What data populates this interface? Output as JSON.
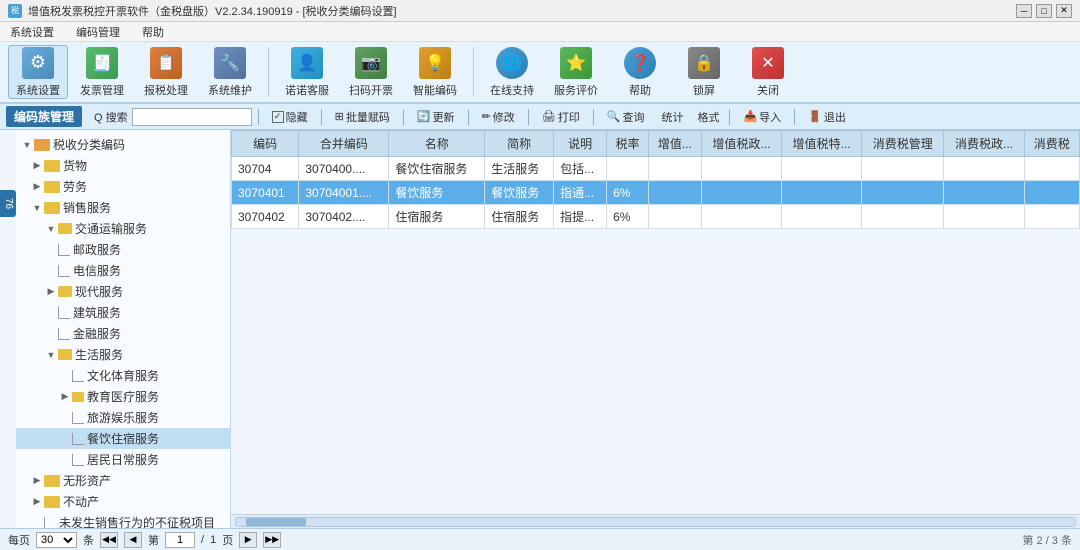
{
  "titleBar": {
    "title": "增值税发票税控开票软件（金税盘版）V2.2.34.190919 - [税收分类编码设置]",
    "controls": [
      "─",
      "□",
      "✕"
    ]
  },
  "menuBar": {
    "items": [
      "系统设置",
      "编码管理",
      "帮助"
    ]
  },
  "toolbar": {
    "buttons": [
      {
        "id": "sys-settings",
        "label": "系统设置",
        "icon": "⚙"
      },
      {
        "id": "invoice-mgmt",
        "label": "发票管理",
        "icon": "🧾"
      },
      {
        "id": "tax-process",
        "label": "报税处理",
        "icon": "📋"
      },
      {
        "id": "sys-maintain",
        "label": "系统维护",
        "icon": "🔧"
      },
      {
        "id": "nuonuo",
        "label": "诺诺客服",
        "icon": "👤"
      },
      {
        "id": "scan-invoice",
        "label": "扫码开票",
        "icon": "📷"
      },
      {
        "id": "smart-code",
        "label": "智能编码",
        "icon": "💡"
      },
      {
        "id": "online-support",
        "label": "在线支持",
        "icon": "🌐"
      },
      {
        "id": "evaluate",
        "label": "服务评价",
        "icon": "⭐"
      },
      {
        "id": "help",
        "label": "帮助",
        "icon": "❓"
      },
      {
        "id": "lock-screen",
        "label": "锁屏",
        "icon": "🔒"
      },
      {
        "id": "close",
        "label": "关闭",
        "icon": "✕"
      }
    ]
  },
  "actionBar": {
    "sectionTitle": "编码族管理",
    "searchLabel": "Q 搜索",
    "searchPlaceholder": "",
    "buttons": [
      {
        "id": "hide",
        "label": "隐藏",
        "hasCheckbox": true
      },
      {
        "id": "batch-assign",
        "label": "批量赋码"
      },
      {
        "id": "update",
        "label": "更新"
      },
      {
        "id": "modify",
        "label": "修改"
      },
      {
        "id": "print",
        "label": "打印"
      },
      {
        "id": "query",
        "label": "查询"
      },
      {
        "id": "stats",
        "label": "统计"
      },
      {
        "id": "grid",
        "label": "格式"
      },
      {
        "id": "import",
        "label": "导入"
      },
      {
        "id": "exit",
        "label": "退出"
      }
    ]
  },
  "sidebar": {
    "title": "税收分类编码",
    "tree": [
      {
        "id": "root",
        "label": "税收分类编码",
        "level": 0,
        "expanded": true,
        "type": "root"
      },
      {
        "id": "goods",
        "label": "货物",
        "level": 1,
        "expanded": false,
        "type": "folder"
      },
      {
        "id": "labor",
        "label": "劳务",
        "level": 1,
        "expanded": false,
        "type": "folder"
      },
      {
        "id": "sales-service",
        "label": "销售服务",
        "level": 1,
        "expanded": true,
        "type": "folder"
      },
      {
        "id": "transport",
        "label": "交通运输服务",
        "level": 2,
        "expanded": false,
        "type": "folder"
      },
      {
        "id": "postal",
        "label": "邮政服务",
        "level": 2,
        "expanded": false,
        "type": "leaf"
      },
      {
        "id": "telecom",
        "label": "电信服务",
        "level": 2,
        "expanded": false,
        "type": "leaf"
      },
      {
        "id": "modern",
        "label": "现代服务",
        "level": 2,
        "expanded": false,
        "type": "folder"
      },
      {
        "id": "construction",
        "label": "建筑服务",
        "level": 2,
        "expanded": false,
        "type": "leaf"
      },
      {
        "id": "finance",
        "label": "金融服务",
        "level": 2,
        "expanded": false,
        "type": "leaf"
      },
      {
        "id": "life",
        "label": "生活服务",
        "level": 2,
        "expanded": true,
        "type": "folder"
      },
      {
        "id": "culture-sport",
        "label": "文化体育服务",
        "level": 3,
        "expanded": false,
        "type": "leaf"
      },
      {
        "id": "edu-medical",
        "label": "教育医疗服务",
        "level": 3,
        "expanded": false,
        "type": "folder"
      },
      {
        "id": "travel-entertainment",
        "label": "旅游娱乐服务",
        "level": 3,
        "expanded": false,
        "type": "leaf"
      },
      {
        "id": "catering-hotel",
        "label": "餐饮住宿服务",
        "level": 3,
        "expanded": false,
        "type": "leaf",
        "selected": true
      },
      {
        "id": "daily-life",
        "label": "居民日常服务",
        "level": 3,
        "expanded": false,
        "type": "leaf"
      },
      {
        "id": "intangible",
        "label": "无形资产",
        "level": 1,
        "expanded": false,
        "type": "folder"
      },
      {
        "id": "realestate",
        "label": "不动产",
        "level": 1,
        "expanded": false,
        "type": "folder"
      },
      {
        "id": "non-sales",
        "label": "未发生销售行为的不征税项目",
        "level": 1,
        "expanded": false,
        "type": "leaf"
      }
    ]
  },
  "table": {
    "columns": [
      "编码",
      "合并编码",
      "名称",
      "简称",
      "说明",
      "税率",
      "增值...",
      "增值税政...",
      "增值税特...",
      "消费税管理",
      "消费税政...",
      "消费税"
    ],
    "rows": [
      {
        "id": "30704",
        "code": "30704",
        "mergeCode": "3070400....",
        "name": "餐饮住宿服务",
        "shortName": "生活服务",
        "note": "包括...",
        "taxRate": "",
        "col7": "",
        "col8": "",
        "col9": "",
        "col10": "",
        "col11": "",
        "col12": "",
        "selected": false
      },
      {
        "id": "3070401",
        "code": "3070401",
        "mergeCode": "30704001....",
        "name": "餐饮服务",
        "shortName": "餐饮服务",
        "note": "指通...",
        "taxRate": "6%",
        "col7": "",
        "col8": "",
        "col9": "",
        "col10": "",
        "col11": "",
        "col12": "",
        "selected": true
      },
      {
        "id": "3070402",
        "code": "3070402",
        "mergeCode": "3070402....",
        "name": "住宿服务",
        "shortName": "住宿服务",
        "note": "指提...",
        "taxRate": "6%",
        "col7": "",
        "col8": "",
        "col9": "",
        "col10": "",
        "col11": "",
        "col12": "",
        "selected": false
      }
    ]
  },
  "pagination": {
    "perPageLabel": "每页",
    "perPageValue": "30",
    "perPageSuffix": "条",
    "prevLabel": "◀",
    "nextLabel": "▶",
    "currentPage": "1",
    "totalPages": "1",
    "pageLabel": "页",
    "rightInfo": "第  2  /  3  条"
  },
  "edgeTabs": [
    {
      "label": "76"
    }
  ],
  "colors": {
    "headerBg": "#c8dff0",
    "selectedRow": "#5baee8",
    "selectedRowLight": "#a8d4f0",
    "sidebarBg": "#f8fbff",
    "toolbarBg": "#e8f4fd",
    "actionBarBg": "#dceefa",
    "sectionTitleBg": "#2a72a8"
  }
}
